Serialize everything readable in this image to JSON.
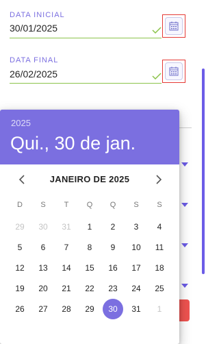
{
  "start_date": {
    "label": "DATA INICIAL",
    "value": "30/01/2025"
  },
  "end_date": {
    "label": "DATA FINAL",
    "value": "26/02/2025"
  },
  "picker": {
    "year": "2025",
    "selected_date_text": "Qui., 30 de jan.",
    "month_label": "JANEIRO DE 2025",
    "weekdays": [
      "D",
      "S",
      "T",
      "Q",
      "Q",
      "S",
      "S"
    ],
    "days": [
      {
        "d": "29",
        "other": true
      },
      {
        "d": "30",
        "other": true
      },
      {
        "d": "31",
        "other": true
      },
      {
        "d": "1"
      },
      {
        "d": "2"
      },
      {
        "d": "3"
      },
      {
        "d": "4"
      },
      {
        "d": "5"
      },
      {
        "d": "6"
      },
      {
        "d": "7"
      },
      {
        "d": "8"
      },
      {
        "d": "9"
      },
      {
        "d": "10"
      },
      {
        "d": "11"
      },
      {
        "d": "12"
      },
      {
        "d": "13"
      },
      {
        "d": "14"
      },
      {
        "d": "15"
      },
      {
        "d": "16"
      },
      {
        "d": "17"
      },
      {
        "d": "18"
      },
      {
        "d": "19"
      },
      {
        "d": "20"
      },
      {
        "d": "21"
      },
      {
        "d": "22"
      },
      {
        "d": "23"
      },
      {
        "d": "24"
      },
      {
        "d": "25"
      },
      {
        "d": "26"
      },
      {
        "d": "27"
      },
      {
        "d": "28"
      },
      {
        "d": "29"
      },
      {
        "d": "30",
        "selected": true
      },
      {
        "d": "31"
      },
      {
        "d": "1",
        "other": true
      }
    ]
  },
  "icons": {
    "calendar": "calendar-icon",
    "check": "check-icon",
    "prev": "chevron-left-icon",
    "next": "chevron-right-icon"
  },
  "colors": {
    "accent": "#7b6fe0",
    "valid_underline": "#8bc34a",
    "highlight_border": "#e53935"
  }
}
